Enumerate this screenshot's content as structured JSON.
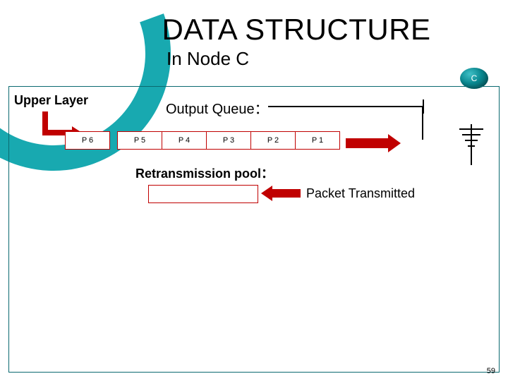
{
  "title": "DATA STRUCTURE",
  "subtitle": "In Node C",
  "node_badge": "C",
  "labels": {
    "upper_layer": "Upper Layer",
    "output_queue": "Output Queue：",
    "retransmission_pool": "Retransmission pool：",
    "packet_transmitted": "Packet Transmitted"
  },
  "queue": {
    "packets": [
      "P 6",
      "P 5",
      "P 4",
      "P 3",
      "P 2",
      "P 1"
    ]
  },
  "page_number": "59",
  "colors": {
    "brand": "#00a0a8",
    "accent_red": "#c00000",
    "frame": "#0a6a70"
  }
}
